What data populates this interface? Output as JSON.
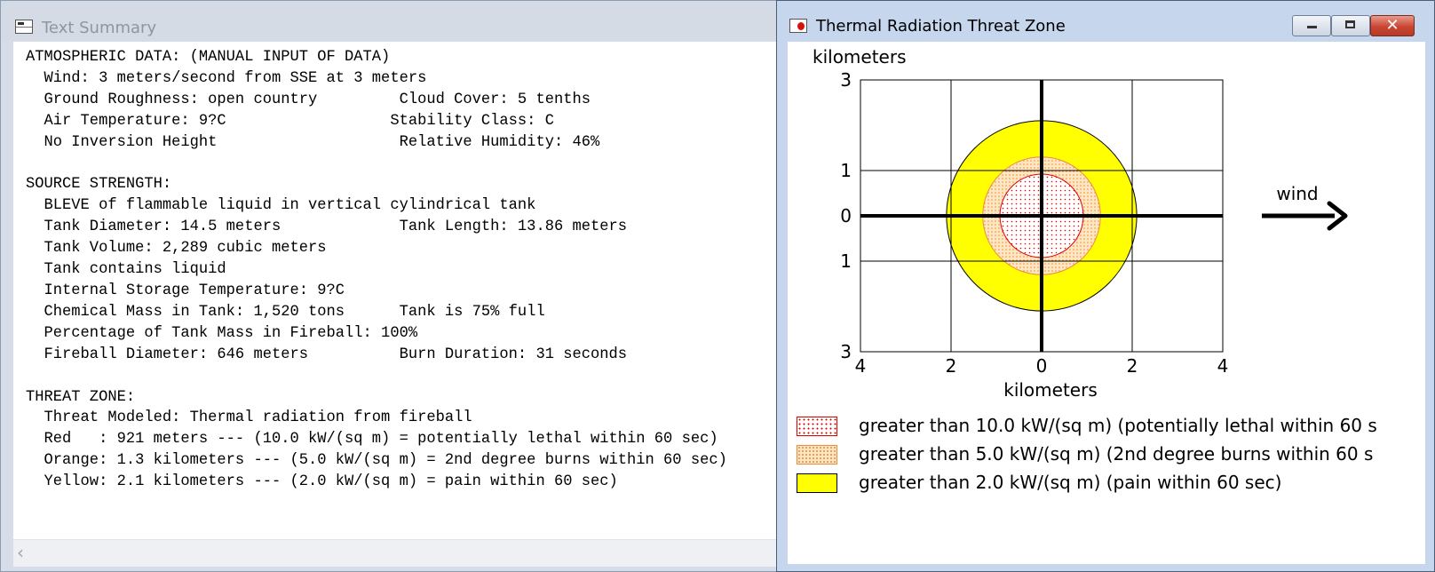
{
  "text_summary": {
    "title": "Text Summary",
    "scroll_left_glyph": "‹",
    "lines": [
      "ATMOSPHERIC DATA: (MANUAL INPUT OF DATA)",
      "  Wind: 3 meters/second from SSE at 3 meters",
      "  Ground Roughness: open country         Cloud Cover: 5 tenths",
      "  Air Temperature: 9?C                  Stability Class: C",
      "  No Inversion Height                    Relative Humidity: 46%",
      "",
      "SOURCE STRENGTH:",
      "  BLEVE of flammable liquid in vertical cylindrical tank",
      "  Tank Diameter: 14.5 meters             Tank Length: 13.86 meters",
      "  Tank Volume: 2,289 cubic meters",
      "  Tank contains liquid",
      "  Internal Storage Temperature: 9?C",
      "  Chemical Mass in Tank: 1,520 tons      Tank is 75% full",
      "  Percentage of Tank Mass in Fireball: 100%",
      "  Fireball Diameter: 646 meters          Burn Duration: 31 seconds",
      "",
      "THREAT ZONE:",
      "  Threat Modeled: Thermal radiation from fireball",
      "  Red   : 921 meters --- (10.0 kW/(sq m) = potentially lethal within 60 sec)",
      "  Orange: 1.3 kilometers --- (5.0 kW/(sq m) = 2nd degree burns within 60 sec)",
      "  Yellow: 2.1 kilometers --- (2.0 kW/(sq m) = pain within 60 sec)"
    ]
  },
  "threat_window": {
    "title": "Thermal Radiation Threat Zone",
    "buttons": {
      "close_glyph": "✕"
    }
  },
  "chart_data": {
    "type": "threat-zone-plot",
    "y_axis_label": "kilometers",
    "x_axis_label": "kilometers",
    "xlim": [
      -4,
      4
    ],
    "ylim": [
      -3,
      3
    ],
    "x_ticks": [
      {
        "value": -4,
        "label": "4"
      },
      {
        "value": -2,
        "label": "2"
      },
      {
        "value": 0,
        "label": "0"
      },
      {
        "value": 2,
        "label": "2"
      },
      {
        "value": 4,
        "label": "4"
      }
    ],
    "y_ticks": [
      {
        "value": 3,
        "label": "3"
      },
      {
        "value": 1,
        "label": "1"
      },
      {
        "value": 0,
        "label": "0"
      },
      {
        "value": -1,
        "label": "1"
      },
      {
        "value": -3,
        "label": "3"
      }
    ],
    "grid": true,
    "wind_label": "wind",
    "zones": [
      {
        "name": "Yellow",
        "radius_km": 2.1,
        "fill": "#ffff00",
        "stroke": "#000000",
        "pattern": "solid"
      },
      {
        "name": "Orange",
        "radius_km": 1.3,
        "fill": "#fce4b8",
        "stroke": "#f08a3a",
        "pattern": "dots-orange"
      },
      {
        "name": "Red",
        "radius_km": 0.921,
        "fill": "#ffffff",
        "stroke": "#e00000",
        "pattern": "dots-red"
      }
    ],
    "legend": [
      {
        "label": "greater than 10.0 kW/(sq m) (potentially lethal within 60 s",
        "color": "#e00000",
        "pattern": "dots-red"
      },
      {
        "label": "greater than 5.0 kW/(sq m) (2nd degree burns within 60 s",
        "color": "#f08a3a",
        "pattern": "dots-orange"
      },
      {
        "label": "greater than 2.0 kW/(sq m) (pain within 60 sec)",
        "color": "#ffff00",
        "pattern": "solid"
      }
    ]
  }
}
